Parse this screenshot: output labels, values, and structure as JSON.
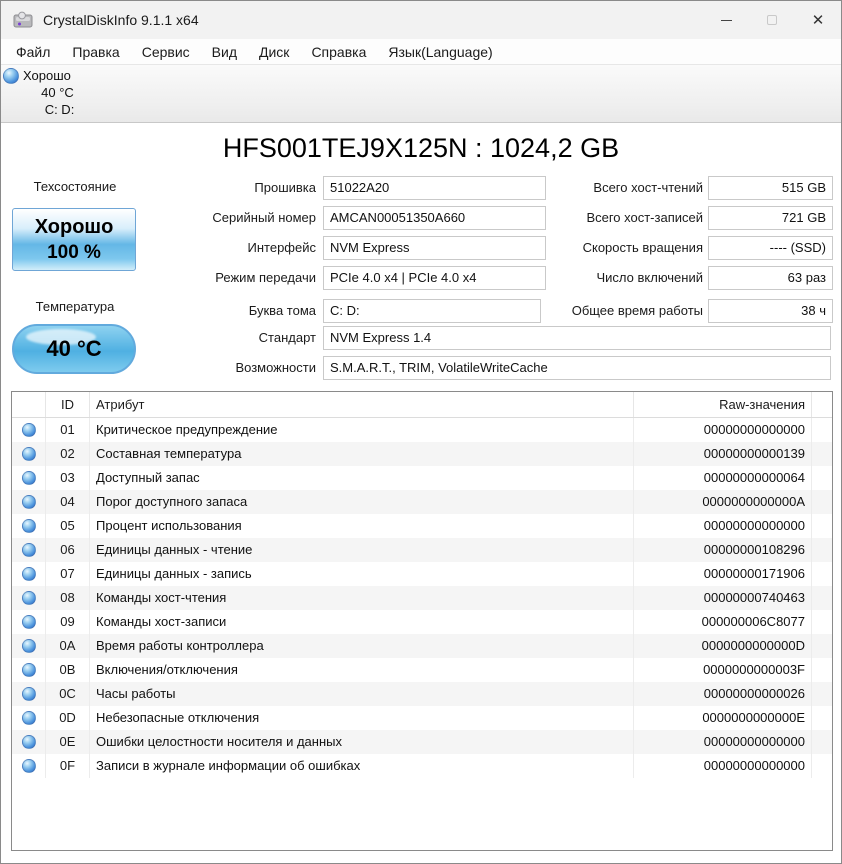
{
  "window": {
    "title": "CrystalDiskInfo 9.1.1 x64"
  },
  "menu": {
    "items": [
      "Файл",
      "Правка",
      "Сервис",
      "Вид",
      "Диск",
      "Справка",
      "Язык(Language)"
    ]
  },
  "tab": {
    "status": "Хорошо",
    "temperature": "40 °C",
    "drives": "C: D:"
  },
  "colors": {
    "accent_purple": "#45129e",
    "status_blue": "#4a92dc"
  },
  "drive": {
    "title": "HFS001TEJ9X125N : 1024,2 GB"
  },
  "health": {
    "label": "Техсостояние",
    "status": "Хорошо",
    "percent": "100 %"
  },
  "temperature": {
    "label": "Температура",
    "value": "40 °C"
  },
  "info_fields": [
    {
      "label": "Прошивка",
      "value": "51022A20"
    },
    {
      "label": "Серийный номер",
      "value": "AMCAN00051350A660"
    },
    {
      "label": "Интерфейс",
      "value": "NVM Express"
    },
    {
      "label": "Режим передачи",
      "value": "PCIe 4.0 x4 | PCIe 4.0 x4"
    },
    {
      "label": "Буква тома",
      "value": "C: D:"
    },
    {
      "label": "Стандарт",
      "value": "NVM Express 1.4"
    },
    {
      "label": "Возможности",
      "value": "S.M.A.R.T., TRIM, VolatileWriteCache"
    }
  ],
  "stat_fields": [
    {
      "label": "Всего хост-чтений",
      "value": "515 GB"
    },
    {
      "label": "Всего хост-записей",
      "value": "721 GB"
    },
    {
      "label": "Скорость вращения",
      "value": "---- (SSD)"
    },
    {
      "label": "Число включений",
      "value": "63 раз"
    },
    {
      "label": "Общее время работы",
      "value": "38 ч"
    }
  ],
  "smart": {
    "headers": {
      "id": "ID",
      "attribute": "Атрибут",
      "raw": "Raw-значения"
    },
    "rows": [
      {
        "id": "01",
        "attribute": "Критическое предупреждение",
        "raw": "00000000000000"
      },
      {
        "id": "02",
        "attribute": "Составная температура",
        "raw": "00000000000139"
      },
      {
        "id": "03",
        "attribute": "Доступный запас",
        "raw": "00000000000064"
      },
      {
        "id": "04",
        "attribute": "Порог доступного запаса",
        "raw": "0000000000000A"
      },
      {
        "id": "05",
        "attribute": "Процент использования",
        "raw": "00000000000000"
      },
      {
        "id": "06",
        "attribute": "Единицы данных - чтение",
        "raw": "00000000108296"
      },
      {
        "id": "07",
        "attribute": "Единицы данных - запись",
        "raw": "00000000171906"
      },
      {
        "id": "08",
        "attribute": "Команды хост-чтения",
        "raw": "00000000740463"
      },
      {
        "id": "09",
        "attribute": "Команды хост-записи",
        "raw": "000000006C8077"
      },
      {
        "id": "0A",
        "attribute": "Время работы контроллера",
        "raw": "0000000000000D"
      },
      {
        "id": "0B",
        "attribute": "Включения/отключения",
        "raw": "0000000000003F"
      },
      {
        "id": "0C",
        "attribute": "Часы работы",
        "raw": "00000000000026"
      },
      {
        "id": "0D",
        "attribute": "Небезопасные отключения",
        "raw": "0000000000000E"
      },
      {
        "id": "0E",
        "attribute": "Ошибки целостности носителя и данных",
        "raw": "00000000000000"
      },
      {
        "id": "0F",
        "attribute": "Записи в журнале информации об ошибках",
        "raw": "00000000000000"
      }
    ]
  }
}
